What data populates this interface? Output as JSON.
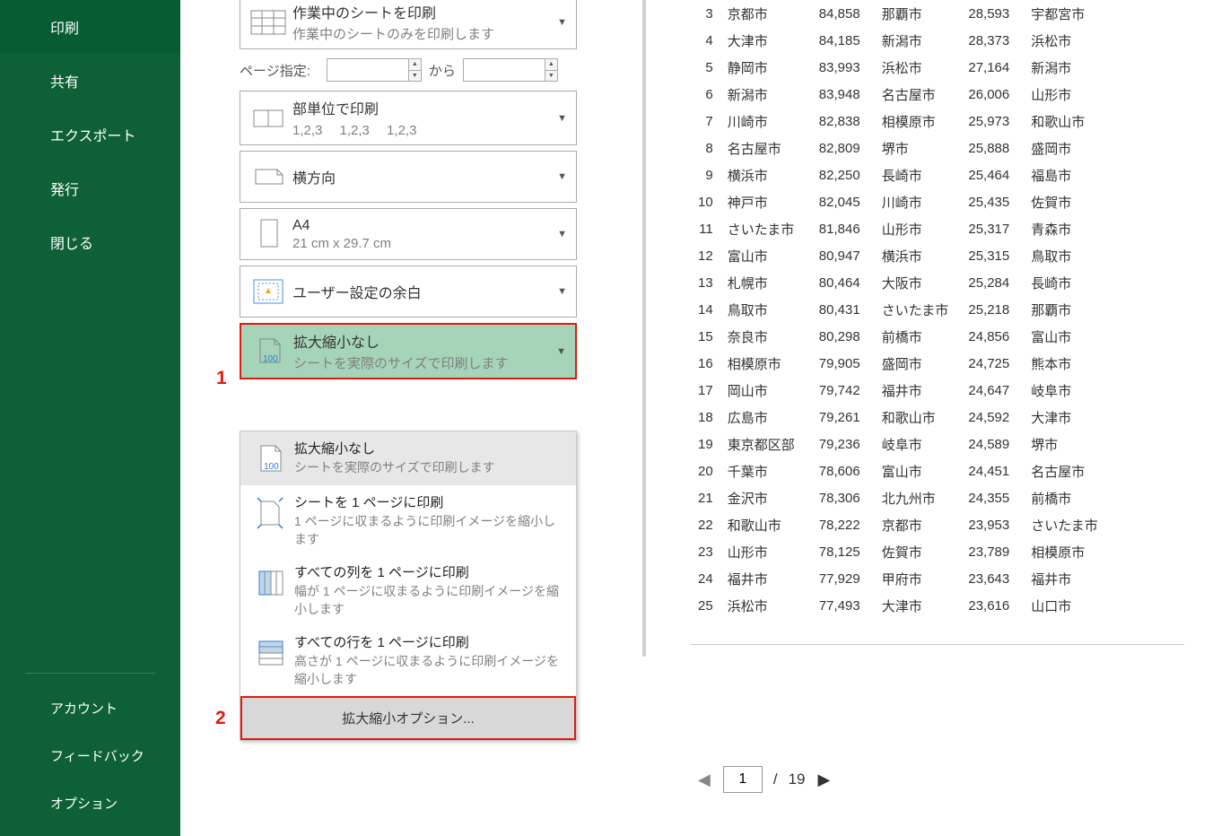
{
  "sidebar": {
    "items": [
      {
        "label": "印刷",
        "active": true
      },
      {
        "label": "共有"
      },
      {
        "label": "エクスポート"
      },
      {
        "label": "発行"
      },
      {
        "label": "閉じる"
      }
    ],
    "bottom": [
      {
        "label": "アカウント"
      },
      {
        "label": "フィードバック"
      },
      {
        "label": "オプション"
      }
    ]
  },
  "settings": {
    "print_what": {
      "title": "作業中のシートを印刷",
      "sub": "作業中のシートのみを印刷します"
    },
    "page_range": {
      "label": "ページ指定:",
      "from_label": "から"
    },
    "collate": {
      "title": "部単位で印刷",
      "sub": "1,2,3　 1,2,3　 1,2,3"
    },
    "orientation": {
      "title": "横方向"
    },
    "paper": {
      "title": "A4",
      "sub": "21 cm x 29.7 cm"
    },
    "margins": {
      "title": "ユーザー設定の余白"
    },
    "scaling": {
      "title": "拡大縮小なし",
      "sub": "シートを実際のサイズで印刷します"
    }
  },
  "callouts": {
    "one": "1",
    "two": "2"
  },
  "scaling_menu": {
    "items": [
      {
        "title": "拡大縮小なし",
        "sub": "シートを実際のサイズで印刷します",
        "selected": true
      },
      {
        "title": "シートを 1 ページに印刷",
        "sub": "1 ページに収まるように印刷イメージを縮小します"
      },
      {
        "title": "すべての列を 1 ページに印刷",
        "sub": "幅が 1 ページに収まるように印刷イメージを縮小します"
      },
      {
        "title": "すべての行を 1 ページに印刷",
        "sub": "高さが 1 ページに収まるように印刷イメージを縮小します"
      }
    ],
    "footer": "拡大縮小オプション..."
  },
  "preview": {
    "rows": [
      {
        "n": 3,
        "c1": "京都市",
        "v1": "84,858",
        "c2": "那覇市",
        "v2": "28,593",
        "c3": "宇都宮市"
      },
      {
        "n": 4,
        "c1": "大津市",
        "v1": "84,185",
        "c2": "新潟市",
        "v2": "28,373",
        "c3": "浜松市"
      },
      {
        "n": 5,
        "c1": "静岡市",
        "v1": "83,993",
        "c2": "浜松市",
        "v2": "27,164",
        "c3": "新潟市"
      },
      {
        "n": 6,
        "c1": "新潟市",
        "v1": "83,948",
        "c2": "名古屋市",
        "v2": "26,006",
        "c3": "山形市"
      },
      {
        "n": 7,
        "c1": "川崎市",
        "v1": "82,838",
        "c2": "相模原市",
        "v2": "25,973",
        "c3": "和歌山市"
      },
      {
        "n": 8,
        "c1": "名古屋市",
        "v1": "82,809",
        "c2": "堺市",
        "v2": "25,888",
        "c3": "盛岡市"
      },
      {
        "n": 9,
        "c1": "横浜市",
        "v1": "82,250",
        "c2": "長崎市",
        "v2": "25,464",
        "c3": "福島市"
      },
      {
        "n": 10,
        "c1": "神戸市",
        "v1": "82,045",
        "c2": "川崎市",
        "v2": "25,435",
        "c3": "佐賀市"
      },
      {
        "n": 11,
        "c1": "さいたま市",
        "v1": "81,846",
        "c2": "山形市",
        "v2": "25,317",
        "c3": "青森市"
      },
      {
        "n": 12,
        "c1": "富山市",
        "v1": "80,947",
        "c2": "横浜市",
        "v2": "25,315",
        "c3": "鳥取市"
      },
      {
        "n": 13,
        "c1": "札幌市",
        "v1": "80,464",
        "c2": "大阪市",
        "v2": "25,284",
        "c3": "長崎市"
      },
      {
        "n": 14,
        "c1": "鳥取市",
        "v1": "80,431",
        "c2": "さいたま市",
        "v2": "25,218",
        "c3": "那覇市"
      },
      {
        "n": 15,
        "c1": "奈良市",
        "v1": "80,298",
        "c2": "前橋市",
        "v2": "24,856",
        "c3": "富山市"
      },
      {
        "n": 16,
        "c1": "相模原市",
        "v1": "79,905",
        "c2": "盛岡市",
        "v2": "24,725",
        "c3": "熊本市"
      },
      {
        "n": 17,
        "c1": "岡山市",
        "v1": "79,742",
        "c2": "福井市",
        "v2": "24,647",
        "c3": "岐阜市"
      },
      {
        "n": 18,
        "c1": "広島市",
        "v1": "79,261",
        "c2": "和歌山市",
        "v2": "24,592",
        "c3": "大津市"
      },
      {
        "n": 19,
        "c1": "東京都区部",
        "v1": "79,236",
        "c2": "岐阜市",
        "v2": "24,589",
        "c3": "堺市"
      },
      {
        "n": 20,
        "c1": "千葉市",
        "v1": "78,606",
        "c2": "富山市",
        "v2": "24,451",
        "c3": "名古屋市"
      },
      {
        "n": 21,
        "c1": "金沢市",
        "v1": "78,306",
        "c2": "北九州市",
        "v2": "24,355",
        "c3": "前橋市"
      },
      {
        "n": 22,
        "c1": "和歌山市",
        "v1": "78,222",
        "c2": "京都市",
        "v2": "23,953",
        "c3": "さいたま市"
      },
      {
        "n": 23,
        "c1": "山形市",
        "v1": "78,125",
        "c2": "佐賀市",
        "v2": "23,789",
        "c3": "相模原市"
      },
      {
        "n": 24,
        "c1": "福井市",
        "v1": "77,929",
        "c2": "甲府市",
        "v2": "23,643",
        "c3": "福井市"
      },
      {
        "n": 25,
        "c1": "浜松市",
        "v1": "77,493",
        "c2": "大津市",
        "v2": "23,616",
        "c3": "山口市"
      }
    ]
  },
  "pager": {
    "current": "1",
    "sep": "/",
    "total": "19"
  }
}
